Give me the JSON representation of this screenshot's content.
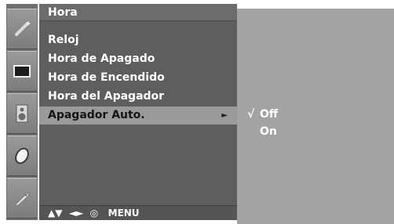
{
  "sidebar": {
    "icons": [
      {
        "name": "setup-wand-icon"
      },
      {
        "name": "picture-icon"
      },
      {
        "name": "audio-speaker-icon"
      },
      {
        "name": "time-clock-icon"
      },
      {
        "name": "option-tag-icon"
      }
    ]
  },
  "menu": {
    "title": "Hora",
    "items": [
      {
        "label": "Reloj"
      },
      {
        "label": "Hora de Apagado"
      },
      {
        "label": "Hora de Encendido"
      },
      {
        "label": "Hora del Apagador"
      },
      {
        "label": "Apagador Auto.",
        "arrow": "►"
      }
    ],
    "footer": "▲▼  ◄►  ◎   MENU"
  },
  "submenu": {
    "options": [
      {
        "check": "√",
        "label": "Off"
      },
      {
        "check": "",
        "label": "On"
      }
    ]
  },
  "colors": {
    "panel": "#5e5e5e",
    "highlight": "#9a9a9a",
    "submenu_bg": "#a3a3a3",
    "text": "#ffffff"
  }
}
